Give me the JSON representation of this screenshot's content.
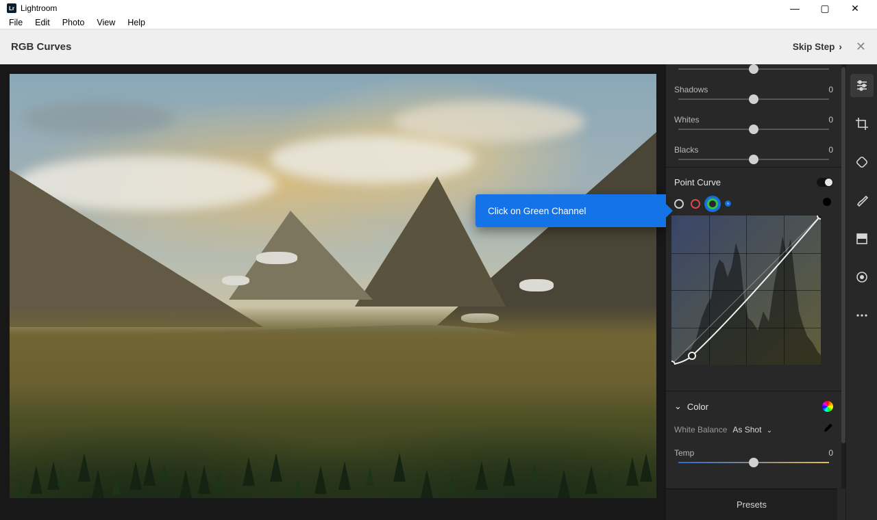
{
  "app": {
    "title": "Lightroom"
  },
  "menu": {
    "file": "File",
    "edit": "Edit",
    "photo": "Photo",
    "view": "View",
    "help": "Help"
  },
  "tutorial": {
    "title": "RGB Curves",
    "skip": "Skip Step",
    "coach": "Click on Green Channel"
  },
  "sliders": {
    "shadows": {
      "label": "Shadows",
      "value": "0"
    },
    "whites": {
      "label": "Whites",
      "value": "0"
    },
    "blacks": {
      "label": "Blacks",
      "value": "0"
    },
    "temp": {
      "label": "Temp",
      "value": "0"
    }
  },
  "sections": {
    "pointcurve": "Point Curve",
    "color": "Color",
    "presets": "Presets"
  },
  "color": {
    "wb_label": "White Balance",
    "wb_value": "As Shot"
  }
}
